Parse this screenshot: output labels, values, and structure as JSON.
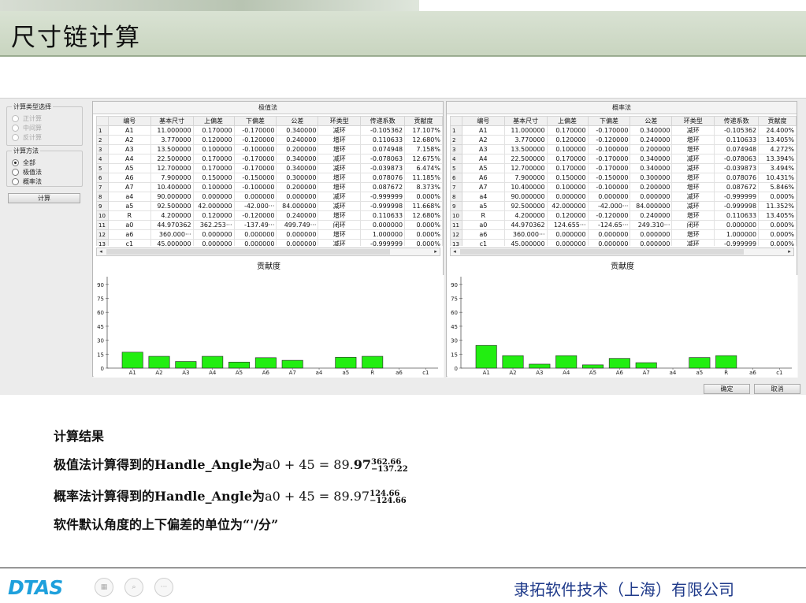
{
  "slide": {
    "title": "尺寸链计算"
  },
  "left_panel": {
    "calc_type_group": "计算类型选择",
    "calc_types": [
      "正计算",
      "中间算",
      "反计算"
    ],
    "method_group": "计算方法",
    "methods": [
      "全部",
      "极值法",
      "概率法"
    ],
    "selected_method": "全部",
    "calc_button": "计算"
  },
  "table_headers": [
    "编号",
    "基本尺寸",
    "上偏差",
    "下偏差",
    "公差",
    "环类型",
    "传递系数",
    "贡献度"
  ],
  "worst_case": {
    "title": "极值法",
    "rows": [
      [
        "1",
        "A1",
        "11.000000",
        "0.170000",
        "-0.170000",
        "0.340000",
        "减环",
        "-0.105362",
        "17.107%"
      ],
      [
        "2",
        "A2",
        "3.770000",
        "0.120000",
        "-0.120000",
        "0.240000",
        "增环",
        "0.110633",
        "12.680%"
      ],
      [
        "3",
        "A3",
        "13.500000",
        "0.100000",
        "-0.100000",
        "0.200000",
        "增环",
        "0.074948",
        "7.158%"
      ],
      [
        "4",
        "A4",
        "22.500000",
        "0.170000",
        "-0.170000",
        "0.340000",
        "减环",
        "-0.078063",
        "12.675%"
      ],
      [
        "5",
        "A5",
        "12.700000",
        "0.170000",
        "-0.170000",
        "0.340000",
        "减环",
        "-0.039873",
        "6.474%"
      ],
      [
        "6",
        "A6",
        "7.900000",
        "0.150000",
        "-0.150000",
        "0.300000",
        "增环",
        "0.078076",
        "11.185%"
      ],
      [
        "7",
        "A7",
        "10.400000",
        "0.100000",
        "-0.100000",
        "0.200000",
        "增环",
        "0.087672",
        "8.373%"
      ],
      [
        "8",
        "a4",
        "90.000000",
        "0.000000",
        "0.000000",
        "0.000000",
        "减环",
        "-0.999999",
        "0.000%"
      ],
      [
        "9",
        "a5",
        "92.500000",
        "42.000000",
        "-42.000···",
        "84.000000",
        "减环",
        "-0.999998",
        "11.668%"
      ],
      [
        "10",
        "R",
        "4.200000",
        "0.120000",
        "-0.120000",
        "0.240000",
        "增环",
        "0.110633",
        "12.680%"
      ],
      [
        "11",
        "a0",
        "44.970362",
        "362.253···",
        "-137.49···",
        "499.749···",
        "闭环",
        "0.000000",
        "0.000%"
      ],
      [
        "12",
        "a6",
        "360.000···",
        "0.000000",
        "0.000000",
        "0.000000",
        "增环",
        "1.000000",
        "0.000%"
      ],
      [
        "13",
        "c1",
        "45.000000",
        "0.000000",
        "0.000000",
        "0.000000",
        "减环",
        "-0.999999",
        "0.000%"
      ]
    ]
  },
  "statistical": {
    "title": "概率法",
    "rows": [
      [
        "1",
        "A1",
        "11.000000",
        "0.170000",
        "-0.170000",
        "0.340000",
        "减环",
        "-0.105362",
        "24.400%"
      ],
      [
        "2",
        "A2",
        "3.770000",
        "0.120000",
        "-0.120000",
        "0.240000",
        "增环",
        "0.110633",
        "13.405%"
      ],
      [
        "3",
        "A3",
        "13.500000",
        "0.100000",
        "-0.100000",
        "0.200000",
        "增环",
        "0.074948",
        "4.272%"
      ],
      [
        "4",
        "A4",
        "22.500000",
        "0.170000",
        "-0.170000",
        "0.340000",
        "减环",
        "-0.078063",
        "13.394%"
      ],
      [
        "5",
        "A5",
        "12.700000",
        "0.170000",
        "-0.170000",
        "0.340000",
        "减环",
        "-0.039873",
        "3.494%"
      ],
      [
        "6",
        "A6",
        "7.900000",
        "0.150000",
        "-0.150000",
        "0.300000",
        "增环",
        "0.078076",
        "10.431%"
      ],
      [
        "7",
        "A7",
        "10.400000",
        "0.100000",
        "-0.100000",
        "0.200000",
        "增环",
        "0.087672",
        "5.846%"
      ],
      [
        "8",
        "a4",
        "90.000000",
        "0.000000",
        "0.000000",
        "0.000000",
        "减环",
        "-0.999999",
        "0.000%"
      ],
      [
        "9",
        "a5",
        "92.500000",
        "42.000000",
        "-42.000···",
        "84.000000",
        "减环",
        "-0.999998",
        "11.352%"
      ],
      [
        "10",
        "R",
        "4.200000",
        "0.120000",
        "-0.120000",
        "0.240000",
        "增环",
        "0.110633",
        "13.405%"
      ],
      [
        "11",
        "a0",
        "44.970362",
        "124.655···",
        "-124.65···",
        "249.310···",
        "闭环",
        "0.000000",
        "0.000%"
      ],
      [
        "12",
        "a6",
        "360.000···",
        "0.000000",
        "0.000000",
        "0.000000",
        "增环",
        "1.000000",
        "0.000%"
      ],
      [
        "13",
        "c1",
        "45.000000",
        "0.000000",
        "0.000000",
        "0.000000",
        "减环",
        "-0.999999",
        "0.000%"
      ]
    ]
  },
  "chart_data": [
    {
      "type": "bar",
      "title": "贡献度",
      "categories": [
        "A1",
        "A2",
        "A3",
        "A4",
        "A5",
        "A6",
        "A7",
        "a4",
        "a5",
        "R",
        "a6",
        "c1"
      ],
      "values": [
        17.107,
        12.68,
        7.158,
        12.675,
        6.474,
        11.185,
        8.373,
        0,
        11.668,
        12.68,
        0,
        0
      ],
      "ylim": [
        0,
        100
      ],
      "yticks": [
        0,
        15,
        30,
        45,
        60,
        75,
        90
      ],
      "bar_color": "#22ee11"
    },
    {
      "type": "bar",
      "title": "贡献度",
      "categories": [
        "A1",
        "A2",
        "A3",
        "A4",
        "A5",
        "A6",
        "A7",
        "a4",
        "a5",
        "R",
        "a6",
        "c1"
      ],
      "values": [
        24.4,
        13.405,
        4.272,
        13.394,
        3.494,
        10.431,
        5.846,
        0,
        11.352,
        13.405,
        0,
        0
      ],
      "ylim": [
        0,
        100
      ],
      "yticks": [
        0,
        15,
        30,
        45,
        60,
        75,
        90
      ],
      "bar_color": "#22ee11"
    }
  ],
  "buttons": {
    "ok": "确定",
    "cancel": "取消"
  },
  "results": {
    "heading": "计算结果",
    "line1_prefix": "极值法计算得到的Handle_Angle为",
    "line1_expr": "a0 + 45 = 89.",
    "line1_bold": "97",
    "line1_upper": "362.66",
    "line1_lower": "−137.22",
    "line2_prefix": "概率法计算得到的Handle_Angle为",
    "line2_expr": "a0 + 45 = 89.97",
    "line2_upper": "124.66",
    "line2_lower": "−124.66",
    "line3": "软件默认角度的上下偏差的单位为“'/分”"
  },
  "footer": {
    "logo": "DTAS",
    "company": "隶拓软件技术（上海）有限公司"
  }
}
